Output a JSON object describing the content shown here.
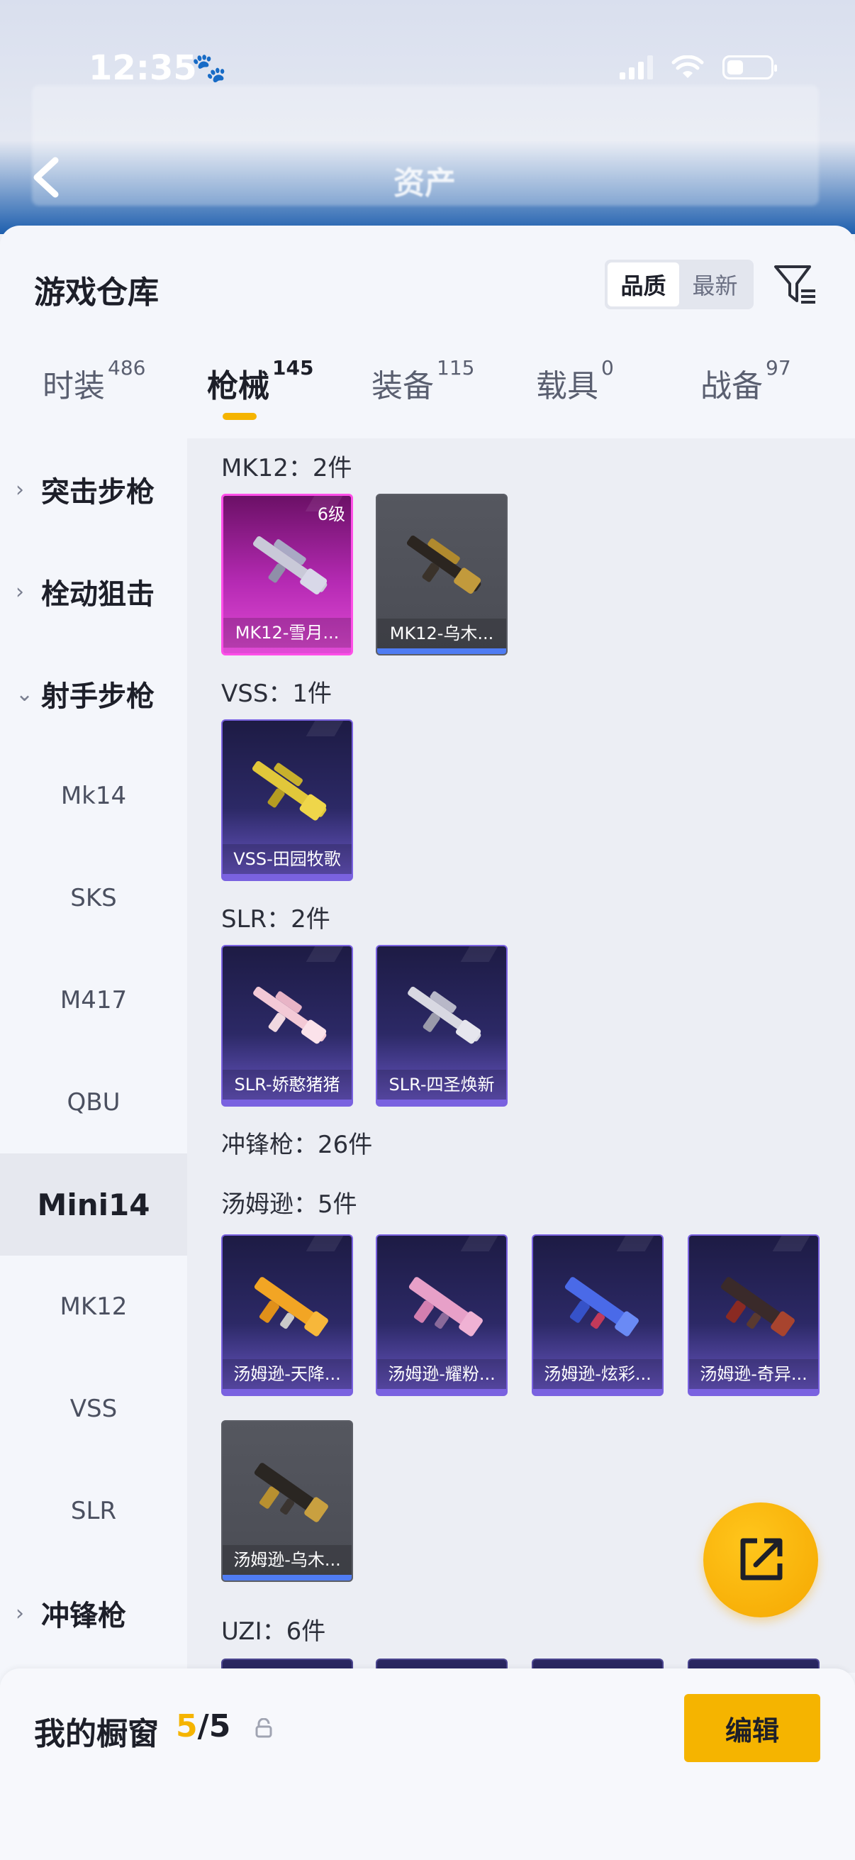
{
  "status": {
    "time": "12:35"
  },
  "header": {
    "title": "资产"
  },
  "sheet": {
    "title": "游戏仓库"
  },
  "sort": {
    "options": [
      "品质",
      "最新"
    ],
    "active": "品质"
  },
  "tabs": [
    {
      "label": "时装",
      "count": "486"
    },
    {
      "label": "枪械",
      "count": "145"
    },
    {
      "label": "装备",
      "count": "115"
    },
    {
      "label": "载具",
      "count": "0"
    },
    {
      "label": "战备",
      "count": "97"
    }
  ],
  "sidebar": {
    "items": [
      {
        "label": "突击步枪"
      },
      {
        "label": "栓动狙击"
      },
      {
        "label": "射手步枪"
      },
      {
        "label": "Mk14"
      },
      {
        "label": "SKS"
      },
      {
        "label": "M417"
      },
      {
        "label": "QBU"
      },
      {
        "label": "Mini14"
      },
      {
        "label": "MK12"
      },
      {
        "label": "VSS"
      },
      {
        "label": "SLR"
      },
      {
        "label": "冲锋枪"
      }
    ]
  },
  "sections": {
    "mk12": {
      "title": "MK12：2件",
      "items": [
        {
          "name": "MK12-雪月...",
          "level": "6级"
        },
        {
          "name": "MK12-乌木..."
        }
      ]
    },
    "vss": {
      "title": "VSS：1件",
      "items": [
        {
          "name": "VSS-田园牧歌"
        }
      ]
    },
    "slr": {
      "title": "SLR：2件",
      "items": [
        {
          "name": "SLR-娇憨猪猪"
        },
        {
          "name": "SLR-四圣焕新"
        }
      ]
    },
    "smg": {
      "title": "冲锋枪：26件"
    },
    "thompson": {
      "title": "汤姆逊：5件",
      "items": [
        {
          "name": "汤姆逊-天降..."
        },
        {
          "name": "汤姆逊-耀粉..."
        },
        {
          "name": "汤姆逊-炫彩..."
        },
        {
          "name": "汤姆逊-奇异..."
        },
        {
          "name": "汤姆逊-乌木..."
        }
      ]
    },
    "uzi": {
      "title": "UZI：6件"
    }
  },
  "showcase": {
    "label": "我的橱窗",
    "current": "5",
    "total": "/5",
    "edit_label": "编辑"
  },
  "colors": {
    "accent": "#f5b400",
    "purple_rarity": "#7a62e0",
    "pink_rarity": "#ff4fe8",
    "blue_bar": "#4f7cf3"
  }
}
